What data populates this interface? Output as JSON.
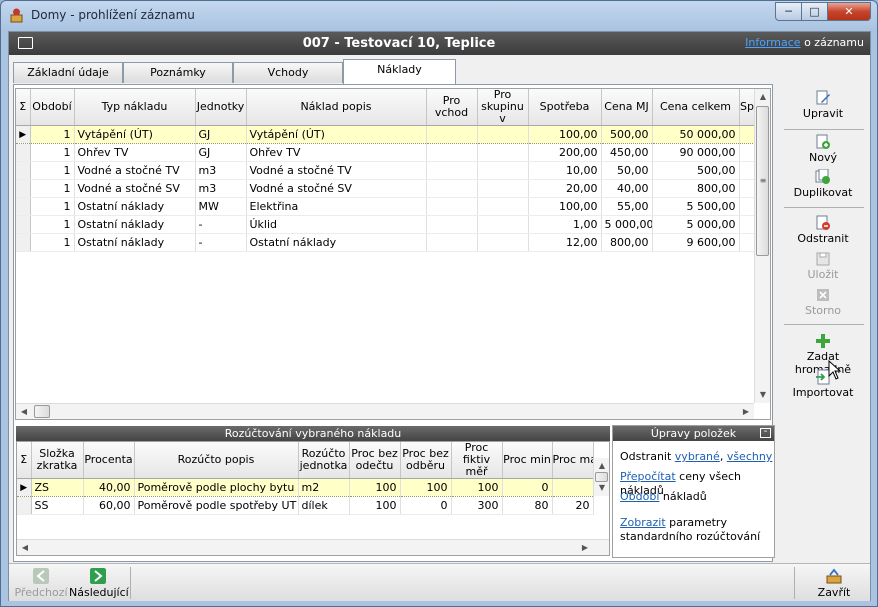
{
  "window": {
    "title": "Domy - prohlížení záznamu",
    "min_glyph": "─",
    "max_glyph": "□",
    "close_glyph": "✕"
  },
  "header": {
    "title": "007 - Testovací 10, Teplice",
    "link_text": "Informace",
    "link_suffix": " o záznamu"
  },
  "tabs": [
    {
      "label": "Základní údaje"
    },
    {
      "label": "Poznámky"
    },
    {
      "label": "Vchody"
    },
    {
      "label": "Náklady"
    }
  ],
  "costs_grid": {
    "sigma": "Σ",
    "columns": [
      "Období",
      "Typ nákladu",
      "Jednotky",
      "Náklad popis",
      "Pro vchod",
      "Pro skupinu v",
      "Spotřeba",
      "Cena MJ",
      "Cena celkem",
      "Sp"
    ],
    "rows": [
      [
        "1",
        "Vytápění (ÚT)",
        "GJ",
        "Vytápění (ÚT)",
        "",
        "",
        "100,00",
        "500,00",
        "50 000,00"
      ],
      [
        "1",
        "Ohřev TV",
        "GJ",
        "Ohřev TV",
        "",
        "",
        "200,00",
        "450,00",
        "90 000,00"
      ],
      [
        "1",
        "Vodné a stočné TV",
        "m3",
        "Vodné a stočné TV",
        "",
        "",
        "10,00",
        "50,00",
        "500,00"
      ],
      [
        "1",
        "Vodné a stočné SV",
        "m3",
        "Vodné a stočné SV",
        "",
        "",
        "20,00",
        "40,00",
        "800,00"
      ],
      [
        "1",
        "Ostatní náklady",
        "MW",
        "Elektřina",
        "",
        "",
        "100,00",
        "55,00",
        "5 500,00"
      ],
      [
        "1",
        "Ostatní náklady",
        "-",
        "Úklid",
        "",
        "",
        "1,00",
        "5 000,00",
        "5 000,00"
      ],
      [
        "1",
        "Ostatní náklady",
        "-",
        "Ostatní náklady",
        "",
        "",
        "12,00",
        "800,00",
        "9 600,00"
      ]
    ],
    "row_marker": "▶"
  },
  "allocation": {
    "title": "Rozúčtování vybraného nákladu",
    "sigma": "Σ",
    "columns": [
      "Složka zkratka",
      "Procenta",
      "Rozúčto popis",
      "Rozúčto jednotka",
      "Proc bez odečtu",
      "Proc bez odběru",
      "Proc fiktiv měř",
      "Proc min",
      "Proc ma"
    ],
    "rows": [
      [
        "ZS",
        "40,00",
        "Poměrově podle plochy bytu",
        "m2",
        "100",
        "100",
        "100",
        "0",
        ""
      ],
      [
        "SS",
        "60,00",
        "Poměrově podle spotřeby UT",
        "dílek",
        "100",
        "0",
        "300",
        "80",
        "20"
      ]
    ]
  },
  "edits_panel": {
    "title": "Úpravy položek",
    "line1_prefix": "Odstranit ",
    "line1_link1": "vybrané",
    "line1_sep": ", ",
    "line1_link2": "všechny",
    "line2_link": "Přepočítat",
    "line2_suffix": " ceny všech nákladů",
    "line3_link": "Období",
    "line3_suffix": " nákladů",
    "line4_link": "Zobrazit",
    "line4_suffix": " parametry",
    "line5": "standardního rozúčtování"
  },
  "side_buttons": {
    "edit": "Upravit",
    "new": "Nový",
    "duplicate": "Duplikovat",
    "delete": "Odstranit",
    "save": "Uložit",
    "cancel": "Storno",
    "bulk": "Zadat hromadně",
    "import": "Importovat"
  },
  "footer": {
    "prev": "Předchozí",
    "next": "Následující",
    "close": "Zavřít"
  }
}
